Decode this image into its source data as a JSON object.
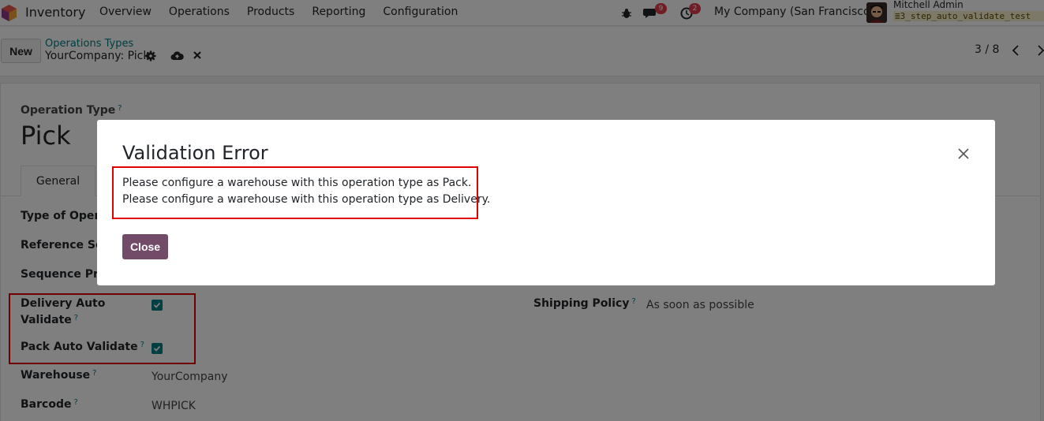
{
  "navbar": {
    "app_name": "Inventory",
    "menu": [
      "Overview",
      "Operations",
      "Products",
      "Reporting",
      "Configuration"
    ],
    "messages_count": "9",
    "activities_count": "2",
    "company": "My Company (San Francisco)",
    "user_name": "Mitchell Admin",
    "db_name": "3_step_auto_validate_test"
  },
  "control": {
    "new_label": "New",
    "breadcrumb_parent": "Operations Types",
    "breadcrumb_current": "YourCompany: Pick",
    "pager": "3 / 8"
  },
  "form": {
    "operation_type_label": "Operation Type",
    "help_mark": "?",
    "operation_type_value": "Pick",
    "tab_general": "General",
    "type_of_operation_label": "Type of Operat",
    "reference_sequence_label": "Reference Sequ",
    "sequence_prefix_label": "Sequence Prefi",
    "delivery_auto_validate_label_1": "Delivery Auto",
    "delivery_auto_validate_label_2": "Validate",
    "pack_auto_validate_label": "Pack Auto Validate",
    "warehouse_label": "Warehouse",
    "warehouse_value": "YourCompany",
    "barcode_label": "Barcode",
    "barcode_value": "WHPICK",
    "shipping_policy_label": "Shipping Policy",
    "shipping_policy_value": "As soon as possible"
  },
  "dialog": {
    "title": "Validation Error",
    "messages": [
      "Please configure a warehouse with this operation type as Pack.",
      "Please configure a warehouse with this operation type as Delivery."
    ],
    "close_label": "Close"
  },
  "colors": {
    "accent": "#017e84",
    "primary_button": "#714b67",
    "badge": "#e13a4b",
    "highlight_box": "#e00000"
  }
}
